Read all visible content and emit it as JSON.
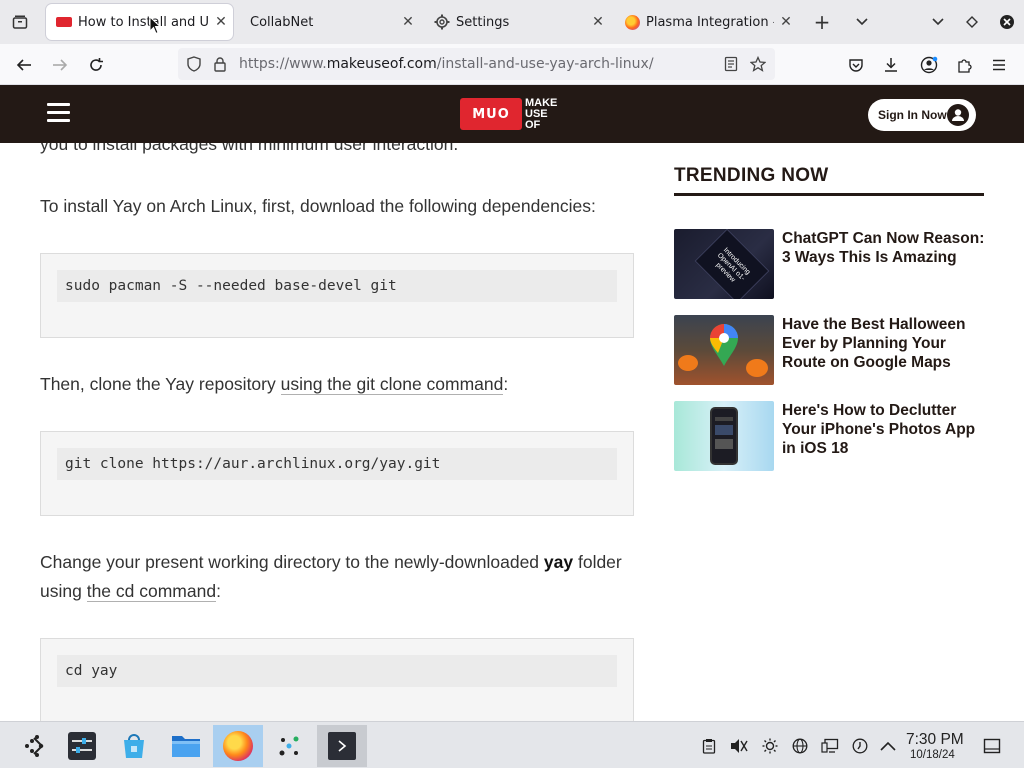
{
  "browser": {
    "tabs": [
      {
        "title": "How to Install and Use",
        "active": true,
        "favicon": "muo-favicon"
      },
      {
        "title": "CollabNet",
        "active": false,
        "favicon": "none"
      },
      {
        "title": "Settings",
        "active": false,
        "favicon": "gear-icon"
      },
      {
        "title": "Plasma Integration -",
        "active": false,
        "favicon": "firefox-icon"
      }
    ],
    "url_prefix": "https://www.",
    "url_domain": "makeuseof.com",
    "url_path": "/install-and-use-yay-arch-linux/"
  },
  "site": {
    "logo_badge": "MUO",
    "logo_text_1": "MAKE",
    "logo_text_2": "USE",
    "logo_text_3": "OF",
    "signin_label": "Sign In Now",
    "brand_color": "#e0262f",
    "header_color": "#231915"
  },
  "article": {
    "para0": "you to install packages with minimum user interaction.",
    "para1": "To install Yay on Arch Linux, first, download the following dependencies:",
    "code1": "sudo pacman -S --needed base-devel git",
    "para2_pre": "Then, clone the Yay repository ",
    "para2_link": "using the git clone command",
    "para2_post": ":",
    "code2": "git clone https://aur.archlinux.org/yay.git",
    "para3_pre": "Change your present working directory to the newly-downloaded ",
    "para3_bold": "yay",
    "para3_mid": " folder using ",
    "para3_link": "the cd command",
    "para3_post": ":",
    "code3": "cd yay"
  },
  "trending": {
    "heading": "TRENDING NOW",
    "items": [
      {
        "title": "ChatGPT Can Now Reason: 3 Ways This Is Amazing",
        "thumb_text": "Introducing OpenAI o1-preview"
      },
      {
        "title": "Have the Best Halloween Ever by Planning Your Route on Google Maps"
      },
      {
        "title": "Here's How to Declutter Your iPhone's Photos App in iOS 18"
      }
    ]
  },
  "taskbar": {
    "apps": [
      "app-launcher-icon",
      "system-settings-icon",
      "discover-store-icon",
      "file-manager-icon",
      "firefox-icon",
      "kde-connect-icon",
      "terminal-icon"
    ],
    "active_app": "firefox-icon",
    "time": "7:30 PM",
    "date": "10/18/24"
  }
}
